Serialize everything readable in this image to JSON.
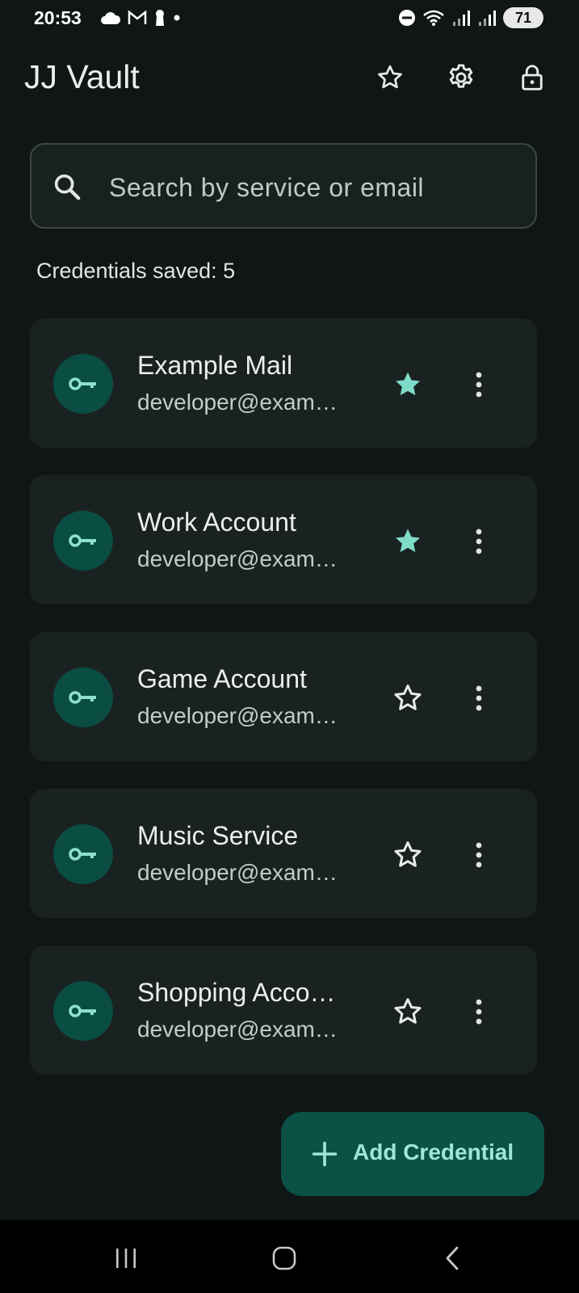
{
  "status_bar": {
    "time": "20:53",
    "battery": "71"
  },
  "app_bar": {
    "title": "JJ Vault",
    "icons": [
      "star-outline-icon",
      "settings-gear-icon",
      "lock-icon"
    ]
  },
  "search": {
    "placeholder": "Search by service or email",
    "value": ""
  },
  "credentials_saved_label": "Credentials saved: 5",
  "credentials": [
    {
      "service": "Example Mail",
      "email": "developer@exam…",
      "favorite": true
    },
    {
      "service": "Work Account",
      "email": "developer@exam…",
      "favorite": true
    },
    {
      "service": "Game Account",
      "email": "developer@exam…",
      "favorite": false
    },
    {
      "service": "Music Service",
      "email": "developer@exam…",
      "favorite": false
    },
    {
      "service": "Shopping Acco…",
      "email": "developer@exam…",
      "favorite": false
    }
  ],
  "fab": {
    "label": "Add Credential",
    "icon": "plus-icon"
  },
  "colors": {
    "background": "#0f1615",
    "card": "#1a2221",
    "accent": "#7fdcc8",
    "avatar": "#0a4d43",
    "fab": "#0b5146"
  }
}
